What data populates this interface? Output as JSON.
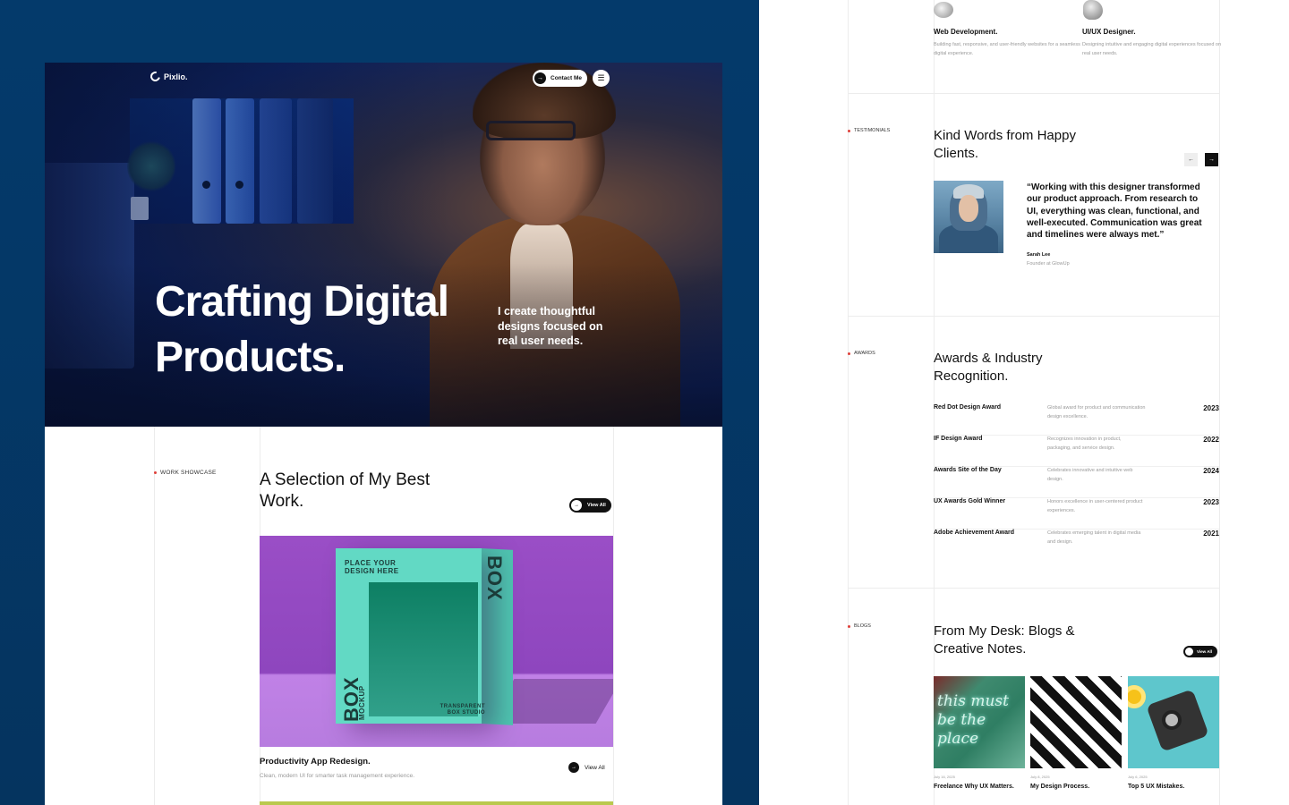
{
  "hero": {
    "logo": "Pixlio.",
    "contact_label": "Contact Me",
    "title": "Crafting Digital Products.",
    "subtitle": "I create thoughtful designs focused on real user needs."
  },
  "work": {
    "tag": "WORK SHOWCASE",
    "title": "A Selection of My Best Work.",
    "view_all": "View All",
    "project": {
      "box_top_label": "PLACE YOUR DESIGN HERE",
      "box_word": "BOX",
      "box_sub": "MOCKUP",
      "box_bottom_label": "TRANSPARENT BOX STUDIO",
      "name": "Productivity App Redesign.",
      "description": "Clean, modern UI for smarter task management experience.",
      "view_all": "View All"
    }
  },
  "services": [
    {
      "title": "Web Development.",
      "description": "Building fast, responsive, and user-friendly websites for a seamless digital experience."
    },
    {
      "title": "UI/UX Designer.",
      "description": "Designing intuitive and engaging digital experiences focused on real user needs."
    }
  ],
  "testimonials": {
    "tag": "TESTIMONIALS",
    "title": "Kind Words from Happy Clients.",
    "prev": "←",
    "next": "→",
    "quote": "“Working with this designer transformed our product approach. From research to UI, everything was clean, functional, and well-executed. Communication was great and timelines were always met.”",
    "name": "Sarah Lee",
    "role": "Founder at GlowUp"
  },
  "awards": {
    "tag": "AWARDS",
    "title": "Awards & Industry Recognition.",
    "items": [
      {
        "name": "Red Dot Design Award",
        "description": "Global award for product and communication design excellence.",
        "year": "2023"
      },
      {
        "name": "IF Design Award",
        "description": "Recognizes innovation in product, packaging, and service design.",
        "year": "2022"
      },
      {
        "name": "Awards Site of the Day",
        "description": "Celebrates innovative and intuitive web design.",
        "year": "2024"
      },
      {
        "name": "UX Awards Gold Winner",
        "description": "Honors excellence in user-centered product experiences.",
        "year": "2023"
      },
      {
        "name": "Adobe Achievement Award",
        "description": "Celebrates emerging talent in digital media and design.",
        "year": "2021"
      }
    ]
  },
  "blogs": {
    "tag": "BLOGS",
    "title": "From My Desk: Blogs & Creative Notes.",
    "view_all": "View All",
    "neon_text": "this must be the place",
    "posts": [
      {
        "date": "July 16, 2025",
        "title": "Freelance Why UX Matters."
      },
      {
        "date": "July 8, 2025",
        "title": "My Design Process."
      },
      {
        "date": "July 6, 2025",
        "title": "Top 5 UX Mistakes."
      }
    ]
  },
  "colors": {
    "page_background": "#043a6b",
    "accent_dot": "#e0403a",
    "button_dark": "#111111"
  }
}
